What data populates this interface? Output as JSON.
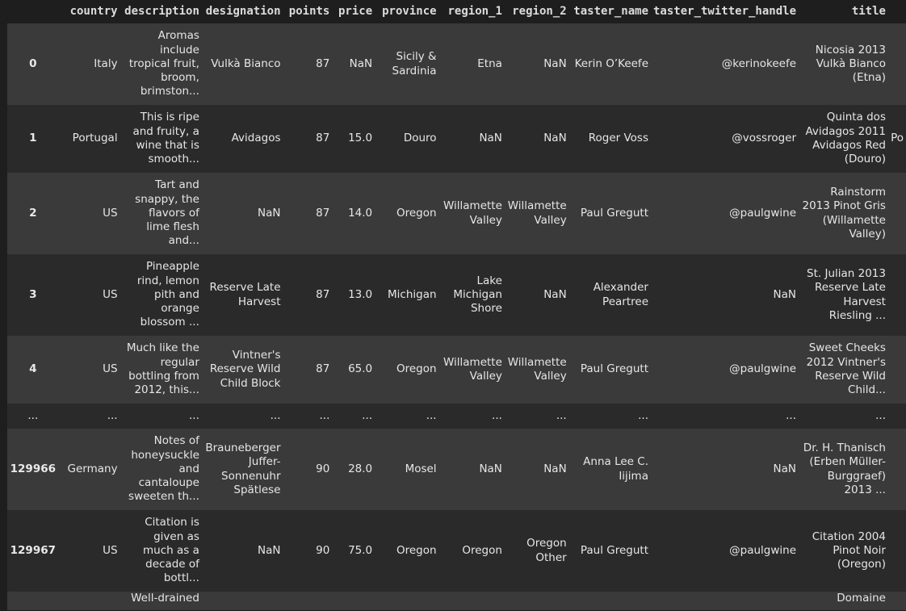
{
  "columns": [
    "",
    "country",
    "description",
    "designation",
    "points",
    "price",
    "province",
    "region_1",
    "region_2",
    "taster_name",
    "taster_twitter_handle",
    "title"
  ],
  "rows": [
    {
      "index": "0",
      "country": "Italy",
      "description": "Aromas include tropical fruit, broom, brimston...",
      "designation": "Vulkà Bianco",
      "points": "87",
      "price": "NaN",
      "province": "Sicily & Sardinia",
      "region_1": "Etna",
      "region_2": "NaN",
      "taster_name": "Kerin O’Keefe",
      "taster_twitter_handle": "@kerinokeefe",
      "title": "Nicosia 2013 Vulkà Bianco (Etna)",
      "overflow": ""
    },
    {
      "index": "1",
      "country": "Portugal",
      "description": "This is ripe and fruity, a wine that is smooth...",
      "designation": "Avidagos",
      "points": "87",
      "price": "15.0",
      "province": "Douro",
      "region_1": "NaN",
      "region_2": "NaN",
      "taster_name": "Roger Voss",
      "taster_twitter_handle": "@vossroger",
      "title": "Quinta dos Avidagos 2011 Avidagos Red (Douro)",
      "overflow": "Po"
    },
    {
      "index": "2",
      "country": "US",
      "description": "Tart and snappy, the flavors of lime flesh and...",
      "designation": "NaN",
      "points": "87",
      "price": "14.0",
      "province": "Oregon",
      "region_1": "Willamette Valley",
      "region_2": "Willamette Valley",
      "taster_name": "Paul Gregutt",
      "taster_twitter_handle": "@paulgwine",
      "title": "Rainstorm 2013 Pinot Gris (Willamette Valley)",
      "overflow": ""
    },
    {
      "index": "3",
      "country": "US",
      "description": "Pineapple rind, lemon pith and orange blossom ...",
      "designation": "Reserve Late Harvest",
      "points": "87",
      "price": "13.0",
      "province": "Michigan",
      "region_1": "Lake Michigan Shore",
      "region_2": "NaN",
      "taster_name": "Alexander Peartree",
      "taster_twitter_handle": "NaN",
      "title": "St. Julian 2013 Reserve Late Harvest Riesling ...",
      "overflow": ""
    },
    {
      "index": "4",
      "country": "US",
      "description": "Much like the regular bottling from 2012, this...",
      "designation": "Vintner's Reserve Wild Child Block",
      "points": "87",
      "price": "65.0",
      "province": "Oregon",
      "region_1": "Willamette Valley",
      "region_2": "Willamette Valley",
      "taster_name": "Paul Gregutt",
      "taster_twitter_handle": "@paulgwine",
      "title": "Sweet Cheeks 2012 Vintner's Reserve Wild Child...",
      "overflow": ""
    }
  ],
  "ellipsis": "...",
  "tail_rows": [
    {
      "index": "129966",
      "country": "Germany",
      "description": "Notes of honeysuckle and cantaloupe sweeten th...",
      "designation": "Brauneberger Juffer-Sonnenuhr Spätlese",
      "points": "90",
      "price": "28.0",
      "province": "Mosel",
      "region_1": "NaN",
      "region_2": "NaN",
      "taster_name": "Anna Lee C. Iijima",
      "taster_twitter_handle": "NaN",
      "title": "Dr. H. Thanisch (Erben Müller-Burggraef) 2013 ...",
      "overflow": ""
    },
    {
      "index": "129967",
      "country": "US",
      "description": "Citation is given as much as a decade of bottl...",
      "designation": "NaN",
      "points": "90",
      "price": "75.0",
      "province": "Oregon",
      "region_1": "Oregon",
      "region_2": "Oregon Other",
      "taster_name": "Paul Gregutt",
      "taster_twitter_handle": "@paulgwine",
      "title": "Citation 2004 Pinot Noir (Oregon)",
      "overflow": ""
    },
    {
      "index": "",
      "country": "",
      "description": "Well-drained",
      "designation": "",
      "points": "",
      "price": "",
      "province": "",
      "region_1": "",
      "region_2": "",
      "taster_name": "",
      "taster_twitter_handle": "",
      "title": "Domaine",
      "overflow": ""
    }
  ],
  "colors": {
    "background": "#1e1e1e",
    "row_odd": "#3a3a3a",
    "row_even": "#2a2a2a",
    "text": "#e6e6e6"
  }
}
